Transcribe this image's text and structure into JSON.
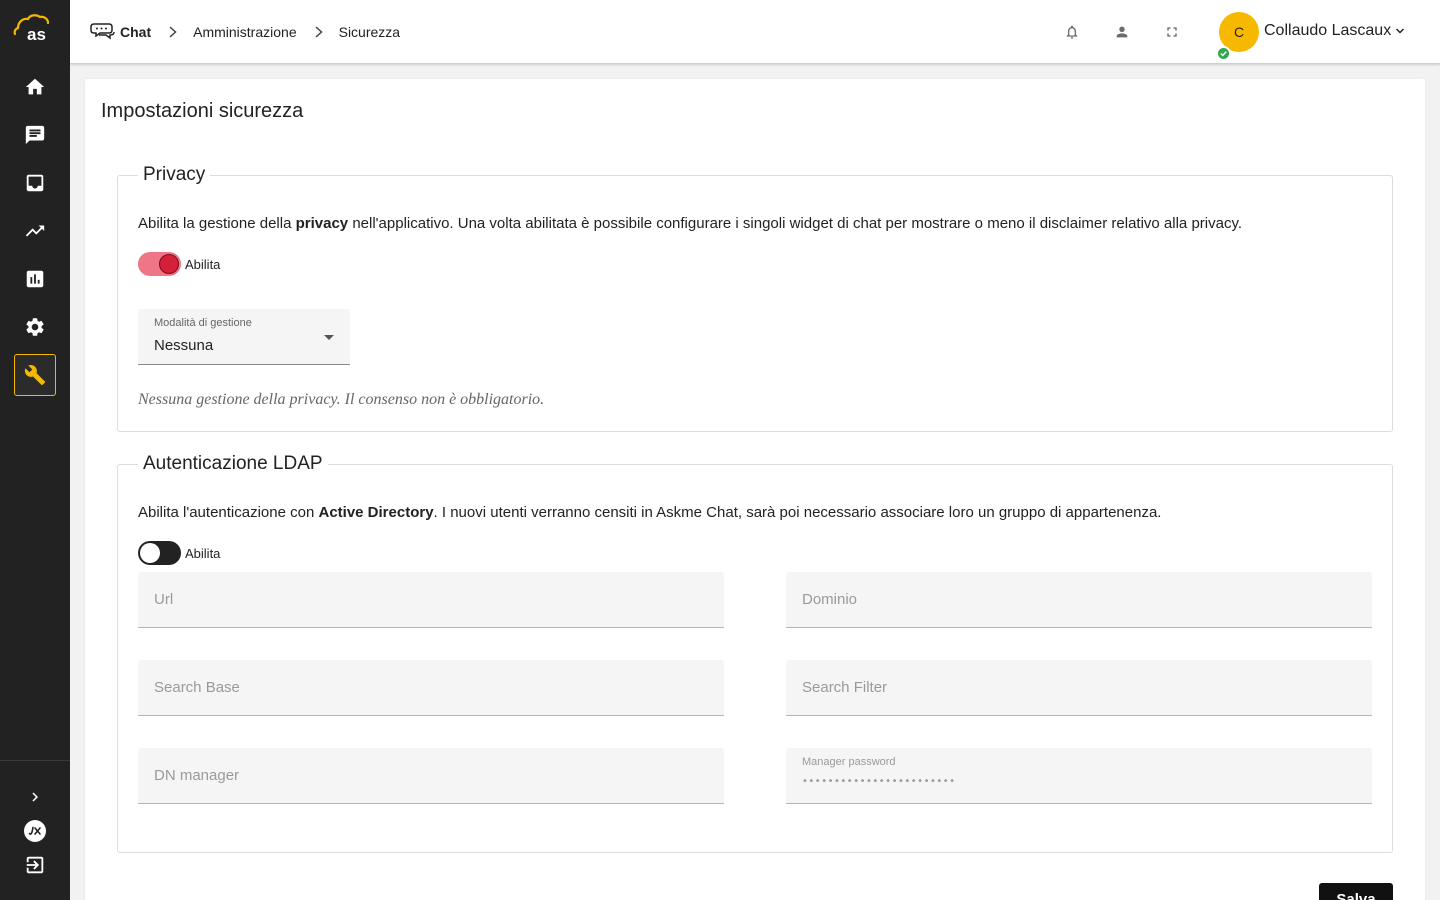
{
  "colors": {
    "sidebar_bg": "#222222",
    "accent": "#f5b800",
    "toggle_on_track": "#ee7686",
    "toggle_on_knob": "#d5203a",
    "status_online": "#2fa84f"
  },
  "sidebar": {
    "logo_text": "as",
    "items": [
      {
        "icon": "home-icon"
      },
      {
        "icon": "chat-icon"
      },
      {
        "icon": "inbox-icon"
      },
      {
        "icon": "trending-icon"
      },
      {
        "icon": "bar-chart-icon"
      },
      {
        "icon": "gear-icon"
      },
      {
        "icon": "wrench-icon",
        "active": true
      }
    ],
    "bottom_items": [
      {
        "icon": "chevron-right-icon"
      },
      {
        "icon": "lx-icon"
      },
      {
        "icon": "logout-icon"
      }
    ]
  },
  "header": {
    "breadcrumb": [
      "Chat",
      "Amministrazione",
      "Sicurezza"
    ],
    "icons": [
      "bell-icon",
      "person-icon",
      "fullscreen-icon"
    ],
    "user": {
      "initial": "C",
      "name": "Collaudo Lascaux",
      "status": "online"
    }
  },
  "page": {
    "title": "Impostazioni sicurezza",
    "privacy": {
      "legend": "Privacy",
      "desc_pre": "Abilita la gestione della ",
      "desc_bold": "privacy",
      "desc_post": " nell'applicativo. Una volta abilitata è possibile configurare i singoli widget di chat per mostrare o meno il disclaimer relativo alla privacy.",
      "toggle_label": "Abilita",
      "toggle_on": true,
      "select_label": "Modalità di gestione",
      "select_value": "Nessuna",
      "hint": "Nessuna gestione della privacy. Il consenso non è obbligatorio."
    },
    "ldap": {
      "legend": "Autenticazione LDAP",
      "desc_pre": "Abilita l'autenticazione con ",
      "desc_bold": "Active Directory",
      "desc_post": ". I nuovi utenti verranno censiti in Askme Chat, sarà poi necessario associare loro un gruppo di appartenenza.",
      "toggle_label": "Abilita",
      "toggle_on": false,
      "fields": {
        "url": "Url",
        "dominio": "Dominio",
        "search_base": "Search Base",
        "search_filter": "Search Filter",
        "dn_manager": "DN manager",
        "manager_password_label": "Manager password",
        "manager_password_value": "••••••••••••••••••••••••"
      }
    },
    "save_label": "Salva"
  }
}
